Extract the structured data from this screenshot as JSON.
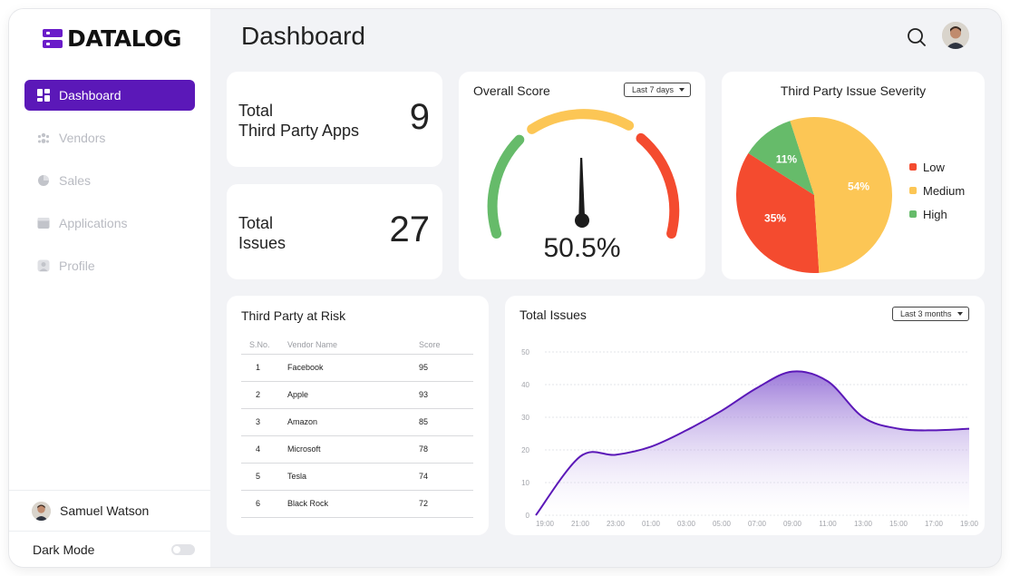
{
  "app": {
    "logo_text": "DATALOG"
  },
  "sidebar": {
    "items": [
      {
        "label": "Dashboard",
        "icon": "dashboard-icon",
        "active": true
      },
      {
        "label": "Vendors",
        "icon": "vendors-icon",
        "active": false
      },
      {
        "label": "Sales",
        "icon": "pie-chart-icon",
        "active": false
      },
      {
        "label": "Applications",
        "icon": "applications-icon",
        "active": false
      },
      {
        "label": "Profile",
        "icon": "profile-icon",
        "active": false
      }
    ],
    "user_name": "Samuel Watson",
    "dark_mode_label": "Dark Mode",
    "dark_mode_on": false
  },
  "header": {
    "title": "Dashboard"
  },
  "stats": {
    "apps": {
      "label": "Total\nThird Party Apps",
      "value": "9"
    },
    "issues": {
      "label": "Total\nIssues",
      "value": "27"
    }
  },
  "overall_score": {
    "title": "Overall Score",
    "range": "Last 7 days",
    "value": "50.5%",
    "score": 50.5
  },
  "severity": {
    "title": "Third Party Issue Severity",
    "legend": [
      {
        "label": "Low",
        "color": "#f44b2f"
      },
      {
        "label": "Medium",
        "color": "#fcc655"
      },
      {
        "label": "High",
        "color": "#66bb6a"
      }
    ]
  },
  "risk_table": {
    "title": "Third Party at Risk",
    "columns": [
      "S.No.",
      "Vendor Name",
      "Score"
    ],
    "rows": [
      [
        "1",
        "Facebook",
        "95"
      ],
      [
        "2",
        "Apple",
        "93"
      ],
      [
        "3",
        "Amazon",
        "85"
      ],
      [
        "4",
        "Microsoft",
        "78"
      ],
      [
        "5",
        "Tesla",
        "74"
      ],
      [
        "6",
        "Black Rock",
        "72"
      ]
    ]
  },
  "total_issues": {
    "title": "Total Issues",
    "range": "Last 3 months"
  },
  "chart_data": [
    {
      "type": "pie",
      "title": "Third Party Issue Severity",
      "slices": [
        {
          "label": "Low",
          "value": 35,
          "text": "35%",
          "color": "#f44b2f"
        },
        {
          "label": "High",
          "value": 11,
          "text": "11%",
          "color": "#66bb6a"
        },
        {
          "label": "Medium",
          "value": 54,
          "text": "54%",
          "color": "#fcc655"
        }
      ]
    },
    {
      "type": "area",
      "title": "Total Issues",
      "x": [
        "19:00",
        "21:00",
        "23:00",
        "01:00",
        "03:00",
        "05:00",
        "07:00",
        "09:00",
        "11:00",
        "13:00",
        "15:00",
        "17:00",
        "19:00"
      ],
      "y": [
        0,
        18,
        18.5,
        21,
        26,
        32,
        39,
        44,
        41,
        30,
        26.5,
        26,
        26.5
      ],
      "yticks": [
        0,
        10,
        20,
        30,
        40,
        50
      ],
      "ylim": [
        0,
        50
      ],
      "grid": true,
      "line_color": "#5b18b8"
    }
  ]
}
